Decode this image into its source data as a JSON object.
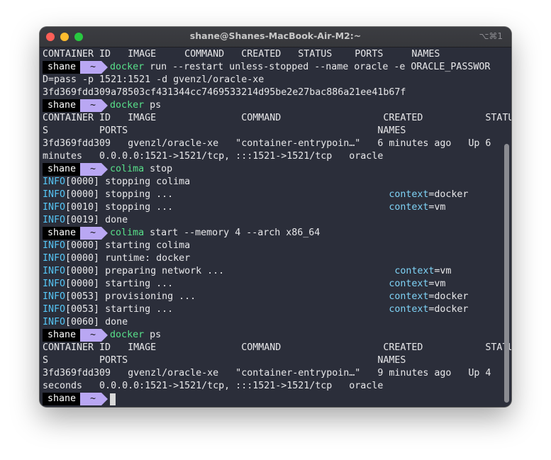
{
  "window": {
    "title": "shane@Shanes-MacBook-Air-M2:~",
    "shortcut": "⌥⌘1"
  },
  "prompt": {
    "user": "shane",
    "dir": "~"
  },
  "lines": [
    {
      "type": "text",
      "text": "CONTAINER ID   IMAGE     COMMAND   CREATED   STATUS    PORTS     NAMES"
    },
    {
      "type": "prompt",
      "cmd": "docker",
      "args": "run --restart unless-stopped --name oracle -e ORACLE_PASSWOR"
    },
    {
      "type": "text",
      "text": "D=pass -p 1521:1521 -d gvenzl/oracle-xe"
    },
    {
      "type": "text",
      "text": "3fd369fdd309a78503cf431344cc7469533214d95be2e27bac886a21ee41b67f"
    },
    {
      "type": "prompt",
      "cmd": "docker",
      "args": "ps"
    },
    {
      "type": "text",
      "text": "CONTAINER ID   IMAGE               COMMAND                  CREATED           STATU"
    },
    {
      "type": "text",
      "text": "S         PORTS                                            NAMES"
    },
    {
      "type": "text",
      "text": "3fd369fdd309   gvenzl/oracle-xe   \"container-entrypoin…\"   6 minutes ago   Up 6"
    },
    {
      "type": "text",
      "text": "minutes   0.0.0.0:1521->1521/tcp, :::1521->1521/tcp   oracle"
    },
    {
      "type": "prompt",
      "cmd": "colima",
      "args": "stop"
    },
    {
      "type": "info",
      "tag": "INFO",
      "text": "[0000] stopping colima",
      "ctxkey": "",
      "ctxval": ""
    },
    {
      "type": "info",
      "tag": "INFO",
      "text": "[0000] stopping ...                                      ",
      "ctxkey": "context",
      "ctxval": "=docker"
    },
    {
      "type": "info",
      "tag": "INFO",
      "text": "[0010] stopping ...                                      ",
      "ctxkey": "context",
      "ctxval": "=vm"
    },
    {
      "type": "info",
      "tag": "INFO",
      "text": "[0019] done",
      "ctxkey": "",
      "ctxval": ""
    },
    {
      "type": "prompt",
      "cmd": "colima",
      "args": "start --memory 4 --arch x86_64"
    },
    {
      "type": "info",
      "tag": "INFO",
      "text": "[0000] starting colima",
      "ctxkey": "",
      "ctxval": ""
    },
    {
      "type": "info",
      "tag": "INFO",
      "text": "[0000] runtime: docker",
      "ctxkey": "",
      "ctxval": ""
    },
    {
      "type": "info",
      "tag": "INFO",
      "text": "[0000] preparing network ...                              ",
      "ctxkey": "context",
      "ctxval": "=vm"
    },
    {
      "type": "info",
      "tag": "INFO",
      "text": "[0000] starting ...                                      ",
      "ctxkey": "context",
      "ctxval": "=vm"
    },
    {
      "type": "info",
      "tag": "INFO",
      "text": "[0053] provisioning ...                                  ",
      "ctxkey": "context",
      "ctxval": "=docker"
    },
    {
      "type": "info",
      "tag": "INFO",
      "text": "[0053] starting ...                                      ",
      "ctxkey": "context",
      "ctxval": "=docker"
    },
    {
      "type": "info",
      "tag": "INFO",
      "text": "[0060] done",
      "ctxkey": "",
      "ctxval": ""
    },
    {
      "type": "prompt",
      "cmd": "docker",
      "args": "ps"
    },
    {
      "type": "text",
      "text": "CONTAINER ID   IMAGE               COMMAND                  CREATED           STATU"
    },
    {
      "type": "text",
      "text": "S         PORTS                                            NAMES"
    },
    {
      "type": "text",
      "text": "3fd369fdd309   gvenzl/oracle-xe   \"container-entrypoin…\"   9 minutes ago   Up 4"
    },
    {
      "type": "text",
      "text": "seconds   0.0.0.0:1521->1521/tcp, :::1521->1521/tcp   oracle"
    },
    {
      "type": "prompt",
      "cmd": "",
      "args": "",
      "cursor": true
    }
  ]
}
